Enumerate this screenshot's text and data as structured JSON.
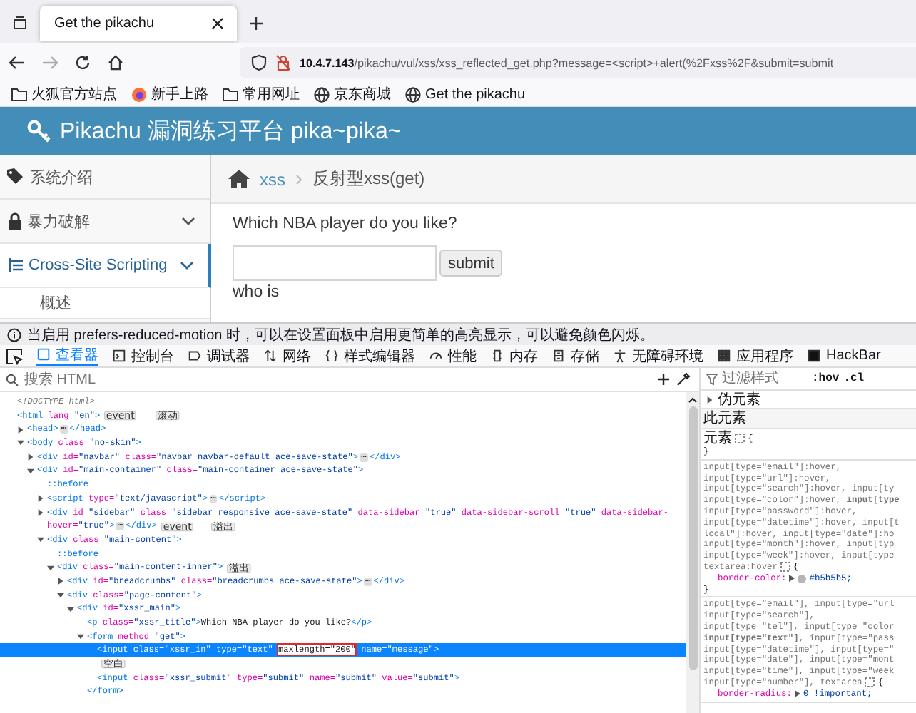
{
  "browser": {
    "tabs": [
      {
        "title": "Get the pikachu",
        "selected": true
      }
    ],
    "address": {
      "host": "10.4.7.143",
      "path": "/pikachu/vul/xss/xss_reflected_get.php?message=<script>+alert(%2Fxss%2F&submit=submit"
    },
    "bookmarks": [
      "火狐官方站点",
      "新手上路",
      "常用网址",
      "京东商城",
      "Get the pikachu"
    ]
  },
  "page": {
    "title": "Pikachu 漏洞练习平台 pika~pika~",
    "sidebar": [
      {
        "kind": "item",
        "label": "系统介绍",
        "selected": false
      },
      {
        "kind": "submenu",
        "label": "暴力破解",
        "selected": false
      },
      {
        "kind": "submenu",
        "label": "Cross-Site Scripting",
        "selected": true
      },
      {
        "kind": "subitem",
        "label": "概述",
        "selected": false
      }
    ],
    "breadcrumbs": [
      {
        "text": "xss",
        "link": true
      },
      {
        "text": "反射型xss(get)",
        "link": false
      }
    ],
    "question": "Which NBA player do you like?",
    "submit": "submit",
    "result": "who is"
  },
  "notice": "当启用 prefers-reduced-motion 时，可以在设置面板中启用更简单的高亮显示，可以避免颜色闪烁。",
  "devtools": {
    "tabs": [
      {
        "label": "查看器",
        "selected": true
      },
      {
        "label": "控制台",
        "selected": false
      },
      {
        "label": "调试器",
        "selected": false
      },
      {
        "label": "网络",
        "selected": false
      },
      {
        "label": "样式编辑器",
        "selected": false
      },
      {
        "label": "性能",
        "selected": false
      },
      {
        "label": "内存",
        "selected": false
      },
      {
        "label": "存储",
        "selected": false
      },
      {
        "label": "无障碍环境",
        "selected": false
      },
      {
        "label": "应用程序",
        "selected": false
      },
      {
        "label": "HackBar",
        "selected": false
      }
    ],
    "search": {
      "placeholder": "搜索 HTML"
    },
    "tree": [
      {
        "selected": false,
        "tokens": [
          {
            "kind": "doctype",
            "text": "<!DOCTYPE html>"
          }
        ]
      },
      {
        "selected": false,
        "tokens": [
          {
            "kind": "tag",
            "text": "<html"
          },
          {
            "kind": "attr",
            "text": " lang="
          },
          {
            "kind": "value",
            "text": "\"en\""
          },
          {
            "kind": "tag",
            "text": ">"
          },
          {
            "kind": "badge",
            "text": "event"
          },
          {
            "kind": "badge",
            "text": "滚动"
          }
        ],
        "children": [
          {
            "selected": false,
            "expanded": false,
            "tokens": [
              {
                "kind": "tag",
                "text": "<head>"
              },
              {
                "kind": "more",
                "text": "⋯"
              },
              {
                "kind": "tag",
                "text": "</head>"
              }
            ]
          },
          {
            "selected": false,
            "expanded": true,
            "tokens": [
              {
                "kind": "tag",
                "text": "<body"
              },
              {
                "kind": "attr",
                "text": " class="
              },
              {
                "kind": "value",
                "text": "\"no-skin\""
              },
              {
                "kind": "tag",
                "text": ">"
              }
            ],
            "children": [
              {
                "selected": false,
                "expanded": false,
                "tokens": [
                  {
                    "kind": "tag",
                    "text": "<div"
                  },
                  {
                    "kind": "attr",
                    "text": " id="
                  },
                  {
                    "kind": "value",
                    "text": "\"navbar\""
                  },
                  {
                    "kind": "attr",
                    "text": " class="
                  },
                  {
                    "kind": "value",
                    "text": "\"navbar navbar-default ace-save-state\""
                  },
                  {
                    "kind": "tag",
                    "text": ">"
                  },
                  {
                    "kind": "more",
                    "text": "⋯"
                  },
                  {
                    "kind": "tag",
                    "text": "</div>"
                  }
                ]
              },
              {
                "selected": false,
                "expanded": true,
                "tokens": [
                  {
                    "kind": "tag",
                    "text": "<div"
                  },
                  {
                    "kind": "attr",
                    "text": " id="
                  },
                  {
                    "kind": "value",
                    "text": "\"main-container\""
                  },
                  {
                    "kind": "attr",
                    "text": " class="
                  },
                  {
                    "kind": "value",
                    "text": "\"main-container ace-save-state\""
                  },
                  {
                    "kind": "tag",
                    "text": ">"
                  }
                ],
                "children": [
                  {
                    "selected": false,
                    "tokens": [
                      {
                        "kind": "pseudo",
                        "text": "::before"
                      }
                    ]
                  },
                  {
                    "selected": false,
                    "expanded": false,
                    "tokens": [
                      {
                        "kind": "tag",
                        "text": "<script"
                      },
                      {
                        "kind": "attr",
                        "text": " type="
                      },
                      {
                        "kind": "value",
                        "text": "\"text/javascript\""
                      },
                      {
                        "kind": "tag",
                        "text": ">"
                      },
                      {
                        "kind": "more",
                        "text": "⋯"
                      },
                      {
                        "kind": "tag",
                        "text": "</script>"
                      }
                    ]
                  },
                  {
                    "selected": false,
                    "expanded": false,
                    "tokens": [
                      {
                        "kind": "tag",
                        "text": "<div"
                      },
                      {
                        "kind": "attr",
                        "text": " id="
                      },
                      {
                        "kind": "value",
                        "text": "\"sidebar\""
                      },
                      {
                        "kind": "attr",
                        "text": " class="
                      },
                      {
                        "kind": "value",
                        "text": "\"sidebar responsive ace-save-state\""
                      },
                      {
                        "kind": "attr",
                        "text": " data-sidebar="
                      },
                      {
                        "kind": "value",
                        "text": "\"true\""
                      },
                      {
                        "kind": "attr",
                        "text": " data-sidebar-scroll="
                      },
                      {
                        "kind": "value",
                        "text": "\"true\""
                      },
                      {
                        "kind": "attr",
                        "text": " data-sidebar-"
                      },
                      {
                        "kind": "break"
                      },
                      {
                        "kind": "attr",
                        "text": "hover="
                      },
                      {
                        "kind": "value",
                        "text": "\"true\""
                      },
                      {
                        "kind": "tag",
                        "text": ">"
                      },
                      {
                        "kind": "more",
                        "text": "⋯"
                      },
                      {
                        "kind": "tag",
                        "text": "</div>"
                      },
                      {
                        "kind": "badge",
                        "text": "event"
                      },
                      {
                        "kind": "badge",
                        "text": "溢出"
                      }
                    ]
                  },
                  {
                    "selected": false,
                    "expanded": true,
                    "tokens": [
                      {
                        "kind": "tag",
                        "text": "<div"
                      },
                      {
                        "kind": "attr",
                        "text": " class="
                      },
                      {
                        "kind": "value",
                        "text": "\"main-content\""
                      },
                      {
                        "kind": "tag",
                        "text": ">"
                      }
                    ],
                    "children": [
                      {
                        "selected": false,
                        "tokens": [
                          {
                            "kind": "pseudo",
                            "text": "::before"
                          }
                        ]
                      },
                      {
                        "selected": false,
                        "expanded": true,
                        "tokens": [
                          {
                            "kind": "tag",
                            "text": "<div"
                          },
                          {
                            "kind": "attr",
                            "text": " class="
                          },
                          {
                            "kind": "value",
                            "text": "\"main-content-inner\""
                          },
                          {
                            "kind": "tag",
                            "text": ">"
                          },
                          {
                            "kind": "badge",
                            "text": "溢出"
                          }
                        ],
                        "children": [
                          {
                            "selected": false,
                            "expanded": false,
                            "tokens": [
                              {
                                "kind": "tag",
                                "text": "<div"
                              },
                              {
                                "kind": "attr",
                                "text": " id="
                              },
                              {
                                "kind": "value",
                                "text": "\"breadcrumbs\""
                              },
                              {
                                "kind": "attr",
                                "text": " class="
                              },
                              {
                                "kind": "value",
                                "text": "\"breadcrumbs ace-save-state\""
                              },
                              {
                                "kind": "tag",
                                "text": ">"
                              },
                              {
                                "kind": "more",
                                "text": "⋯"
                              },
                              {
                                "kind": "tag",
                                "text": "</div>"
                              }
                            ]
                          },
                          {
                            "selected": false,
                            "expanded": true,
                            "tokens": [
                              {
                                "kind": "tag",
                                "text": "<div"
                              },
                              {
                                "kind": "attr",
                                "text": " class="
                              },
                              {
                                "kind": "value",
                                "text": "\"page-content\""
                              },
                              {
                                "kind": "tag",
                                "text": ">"
                              }
                            ],
                            "children": [
                              {
                                "selected": false,
                                "expanded": true,
                                "tokens": [
                                  {
                                    "kind": "tag",
                                    "text": "<div"
                                  },
                                  {
                                    "kind": "attr",
                                    "text": " id="
                                  },
                                  {
                                    "kind": "value",
                                    "text": "\"xssr_main\""
                                  },
                                  {
                                    "kind": "tag",
                                    "text": ">"
                                  }
                                ],
                                "children": [
                                  {
                                    "selected": false,
                                    "tokens": [
                                      {
                                        "kind": "tag",
                                        "text": "<p"
                                      },
                                      {
                                        "kind": "attr",
                                        "text": " class="
                                      },
                                      {
                                        "kind": "value",
                                        "text": "\"xssr_title\""
                                      },
                                      {
                                        "kind": "tag",
                                        "text": ">"
                                      },
                                      {
                                        "kind": "text",
                                        "text": "Which NBA player do you like?"
                                      },
                                      {
                                        "kind": "tag",
                                        "text": "</p>"
                                      }
                                    ]
                                  },
                                  {
                                    "selected": false,
                                    "expanded": true,
                                    "tokens": [
                                      {
                                        "kind": "tag",
                                        "text": "<form"
                                      },
                                      {
                                        "kind": "attr",
                                        "text": " method="
                                      },
                                      {
                                        "kind": "value",
                                        "text": "\"get\""
                                      },
                                      {
                                        "kind": "tag",
                                        "text": ">"
                                      }
                                    ],
                                    "children": [
                                      {
                                        "selected": true,
                                        "tokens": [
                                          {
                                            "kind": "tag",
                                            "text": "<input"
                                          },
                                          {
                                            "kind": "attr",
                                            "text": " class="
                                          },
                                          {
                                            "kind": "value",
                                            "text": "\"xssr_in\""
                                          },
                                          {
                                            "kind": "attr",
                                            "text": " type="
                                          },
                                          {
                                            "kind": "value",
                                            "text": "\"text\" "
                                          },
                                          {
                                            "kind": "boxed",
                                            "text": "maxlength=\"200\""
                                          },
                                          {
                                            "kind": "attr",
                                            "text": " name="
                                          },
                                          {
                                            "kind": "value",
                                            "text": "\"message\""
                                          },
                                          {
                                            "kind": "tag",
                                            "text": ">"
                                          }
                                        ]
                                      },
                                      {
                                        "selected": false,
                                        "tokens": [
                                          {
                                            "kind": "badge",
                                            "text": "空白"
                                          }
                                        ]
                                      },
                                      {
                                        "selected": false,
                                        "tokens": [
                                          {
                                            "kind": "tag",
                                            "text": "<input"
                                          },
                                          {
                                            "kind": "attr",
                                            "text": " class="
                                          },
                                          {
                                            "kind": "value",
                                            "text": "\"xssr_submit\""
                                          },
                                          {
                                            "kind": "attr",
                                            "text": " type="
                                          },
                                          {
                                            "kind": "value",
                                            "text": "\"submit\""
                                          },
                                          {
                                            "kind": "attr",
                                            "text": " name="
                                          },
                                          {
                                            "kind": "value",
                                            "text": "\"submit\""
                                          },
                                          {
                                            "kind": "attr",
                                            "text": " value="
                                          },
                                          {
                                            "kind": "value",
                                            "text": "\"submit\""
                                          },
                                          {
                                            "kind": "tag",
                                            "text": ">"
                                          }
                                        ]
                                      }
                                    ]
                                  },
                                  {
                                    "selected": false,
                                    "tokens": [
                                      {
                                        "kind": "tag",
                                        "text": "</form>"
                                      }
                                    ]
                                  }
                                ]
                              }
                            ]
                          }
                        ]
                      }
                    ]
                  }
                ]
              }
            ]
          }
        ]
      }
    ],
    "styles": {
      "filter": {
        "placeholder": "过滤样式"
      },
      "buttons": [
        ":hov",
        ".cl"
      ],
      "pseudo": {
        "label": "伪元素",
        "expanded": false
      },
      "section": "此元素",
      "rules": [
        {
          "selectors": [
            "元素"
          ],
          "brace": "{",
          "close": "}"
        },
        {
          "selectors": [
            "input[type=\"email\"]:hover,",
            "input[type=\"url\"]:hover,",
            "input[type=\"search\"]:hover, input[ty",
            "input[type=\"color\"]:hover, **input[type**",
            "input[type=\"password\"]:hover,",
            "input[type=\"datetime\"]:hover, input[t",
            "local\"]:hover, input[type=\"date\"]:ho",
            "input[type=\"month\"]:hover, input[typ",
            "input[type=\"week\"]:hover, input[type",
            "textarea:hover"
          ],
          "brace": "{",
          "declarations": [
            {
              "property": "border-color:",
              "value": "#b5b5b5;",
              "color": "#b5b5b5"
            }
          ],
          "close": "}"
        },
        {
          "selectors": [
            "input[type=\"email\"], input[type=\"url",
            "input[type=\"search\"],",
            "input[type=\"tel\"], input[type=\"color",
            "**input[type=\"text\"]**, input[type=\"pass",
            "input[type=\"datetime\"], input[type=\"",
            "input[type=\"date\"], input[type=\"mont",
            "input[type=\"time\"], input[type=\"week",
            "input[type=\"number\"], textarea"
          ],
          "brace": "{",
          "declarations": [
            {
              "property": "border-radius:",
              "value": "0 !important;"
            }
          ]
        }
      ]
    }
  }
}
